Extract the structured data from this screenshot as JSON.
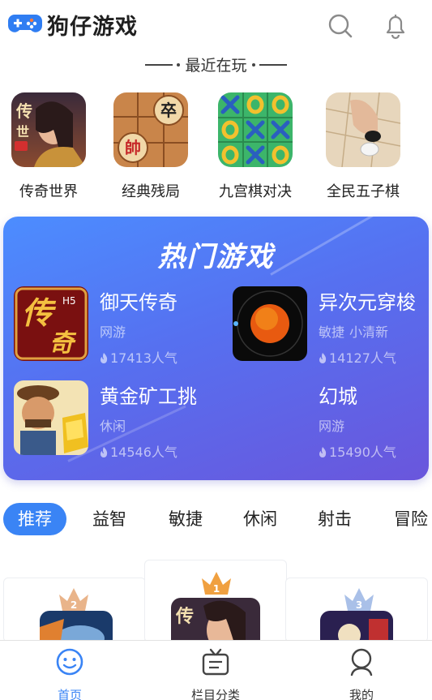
{
  "header": {
    "app_title": "狗仔游戏",
    "logo_icon": "gamepad-icon",
    "search_icon": "search-icon",
    "bell_icon": "bell-icon"
  },
  "recent": {
    "heading": "最近在玩",
    "items": [
      {
        "label": "传奇世界",
        "icon": "legend-world-game-icon"
      },
      {
        "label": "经典残局",
        "icon": "chinese-chess-icon"
      },
      {
        "label": "九宫棋对决",
        "icon": "tic-tac-toe-icon"
      },
      {
        "label": "全民五子棋",
        "icon": "gomoku-icon"
      }
    ]
  },
  "hot": {
    "title": "热门游戏",
    "games": [
      {
        "name": "御天传奇",
        "tags": [
          "网游"
        ],
        "popularity": "17413人气"
      },
      {
        "name": "异次元穿梭",
        "tags": [
          "敏捷",
          "小清新"
        ],
        "popularity": "14127人气"
      },
      {
        "name": "黄金矿工挑",
        "tags": [
          "休闲"
        ],
        "popularity": "14546人气"
      },
      {
        "name": "幻城",
        "tags": [
          "网游"
        ],
        "popularity": "15490人气"
      }
    ]
  },
  "tabs": [
    "推荐",
    "益智",
    "敏捷",
    "休闲",
    "射击",
    "冒险"
  ],
  "active_tab": "推荐",
  "ranking": {
    "ranks": [
      "2",
      "1",
      "3"
    ]
  },
  "bottom_nav": [
    {
      "label": "首页",
      "icon": "smiley-icon",
      "active": true
    },
    {
      "label": "栏目分类",
      "icon": "tv-category-icon",
      "active": false
    },
    {
      "label": "我的",
      "icon": "user-icon",
      "active": false
    }
  ],
  "colors": {
    "accent": "#3a84f5",
    "card_gradient_start": "#4c8dff",
    "card_gradient_end": "#6a56dc"
  }
}
